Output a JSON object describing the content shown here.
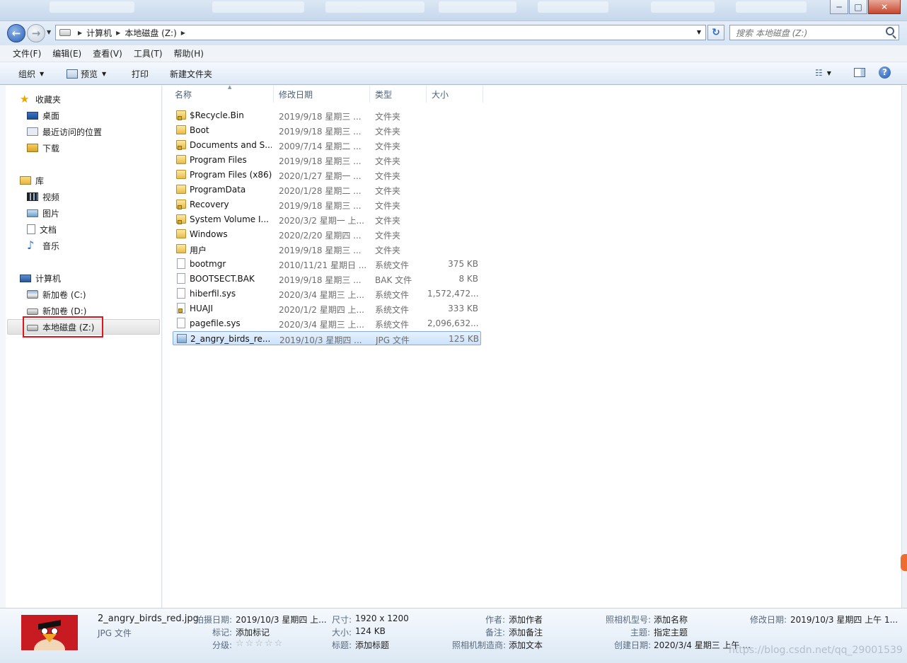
{
  "window": {
    "controls": {
      "minimize": "─",
      "maximize": "□",
      "close": "✕"
    }
  },
  "address": {
    "crumbs": [
      "计算机",
      "本地磁盘 (Z:)"
    ],
    "search_placeholder": "搜索 本地磁盘 (Z:)"
  },
  "menu": [
    "文件(F)",
    "编辑(E)",
    "查看(V)",
    "工具(T)",
    "帮助(H)"
  ],
  "toolbar": {
    "organize": "组织",
    "preview": "预览",
    "print": "打印",
    "new_folder": "新建文件夹",
    "help": "?"
  },
  "nav": {
    "favorites": {
      "title": "收藏夹",
      "items": [
        "桌面",
        "最近访问的位置",
        "下载"
      ]
    },
    "libraries": {
      "title": "库",
      "items": [
        "视频",
        "图片",
        "文档",
        "音乐"
      ]
    },
    "computer": {
      "title": "计算机",
      "items": [
        "新加卷 (C:)",
        "新加卷 (D:)",
        "本地磁盘 (Z:)"
      ]
    }
  },
  "columns": [
    "名称",
    "修改日期",
    "类型",
    "大小"
  ],
  "files": [
    {
      "name": "$Recycle.Bin",
      "date": "2019/9/18 星期三 ...",
      "type": "文件夹",
      "size": "",
      "icon": "folder",
      "locked": true
    },
    {
      "name": "Boot",
      "date": "2019/9/18 星期三 ...",
      "type": "文件夹",
      "size": "",
      "icon": "folder",
      "locked": false
    },
    {
      "name": "Documents and S...",
      "date": "2009/7/14 星期二 ...",
      "type": "文件夹",
      "size": "",
      "icon": "folder",
      "locked": true
    },
    {
      "name": "Program Files",
      "date": "2019/9/18 星期三 ...",
      "type": "文件夹",
      "size": "",
      "icon": "folder",
      "locked": false
    },
    {
      "name": "Program Files (x86)",
      "date": "2020/1/27 星期一 ...",
      "type": "文件夹",
      "size": "",
      "icon": "folder",
      "locked": false
    },
    {
      "name": "ProgramData",
      "date": "2020/1/28 星期二 ...",
      "type": "文件夹",
      "size": "",
      "icon": "folder",
      "locked": false
    },
    {
      "name": "Recovery",
      "date": "2019/9/18 星期三 ...",
      "type": "文件夹",
      "size": "",
      "icon": "folder",
      "locked": true
    },
    {
      "name": "System Volume I...",
      "date": "2020/3/2 星期一 上...",
      "type": "文件夹",
      "size": "",
      "icon": "folder",
      "locked": true
    },
    {
      "name": "Windows",
      "date": "2020/2/20 星期四 ...",
      "type": "文件夹",
      "size": "",
      "icon": "folder",
      "locked": false
    },
    {
      "name": "用户",
      "date": "2019/9/18 星期三 ...",
      "type": "文件夹",
      "size": "",
      "icon": "folder",
      "locked": false
    },
    {
      "name": "bootmgr",
      "date": "2010/11/21 星期日 ...",
      "type": "系统文件",
      "size": "375 KB",
      "icon": "file",
      "locked": false
    },
    {
      "name": "BOOTSECT.BAK",
      "date": "2019/9/18 星期三 ...",
      "type": "BAK 文件",
      "size": "8 KB",
      "icon": "file",
      "locked": false
    },
    {
      "name": "hiberfil.sys",
      "date": "2020/3/4 星期三 上...",
      "type": "系统文件",
      "size": "1,572,472...",
      "icon": "file",
      "locked": false
    },
    {
      "name": "HUAJI",
      "date": "2020/1/2 星期四 上...",
      "type": "系统文件",
      "size": "333 KB",
      "icon": "file",
      "locked": true
    },
    {
      "name": "pagefile.sys",
      "date": "2020/3/4 星期三 上...",
      "type": "系统文件",
      "size": "2,096,632...",
      "icon": "file",
      "locked": false
    },
    {
      "name": "2_angry_birds_re...",
      "date": "2019/10/3 星期四 ...",
      "type": "JPG 文件",
      "size": "125 KB",
      "icon": "image",
      "locked": false,
      "selected": true
    }
  ],
  "details": {
    "filename": "2_angry_birds_red.jpg",
    "filetype": "JPG 文件",
    "fields": [
      {
        "label": "拍摄日期:",
        "value": "2019/10/3 星期四 上..."
      },
      {
        "label": "标记:",
        "value": "添加标记"
      },
      {
        "label": "分级:",
        "value": "☆☆☆☆☆"
      },
      {
        "label": "尺寸:",
        "value": "1920 x 1200"
      },
      {
        "label": "大小:",
        "value": "124 KB"
      },
      {
        "label": "标题:",
        "value": "添加标题"
      },
      {
        "label": "作者:",
        "value": "添加作者"
      },
      {
        "label": "备注:",
        "value": "添加备注"
      },
      {
        "label": "照相机制造商:",
        "value": "添加文本"
      },
      {
        "label": "照相机型号:",
        "value": "添加名称"
      },
      {
        "label": "主题:",
        "value": "指定主题"
      },
      {
        "label": "创建日期:",
        "value": "2020/3/4 星期三 上午 ..."
      },
      {
        "label": "修改日期:",
        "value": "2019/10/3 星期四 上午 1..."
      }
    ],
    "watermark": "https://blog.csdn.net/qq_29001539"
  },
  "colors": {
    "selected_bg": "#cce2fb",
    "redbox": "#e0161b",
    "thumb_red": "#c81b21"
  }
}
